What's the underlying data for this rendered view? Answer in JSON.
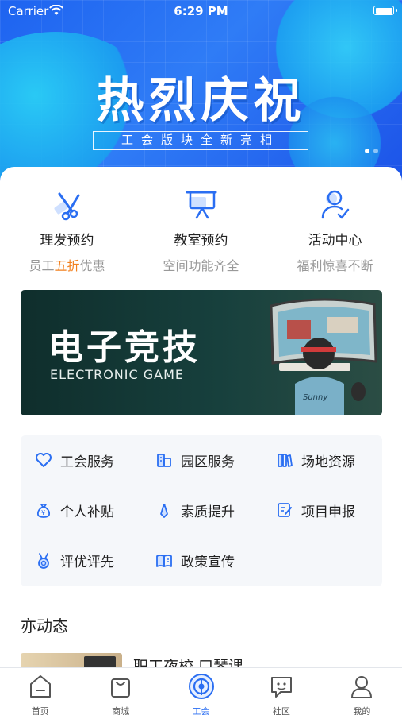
{
  "status_bar": {
    "carrier": "Carrier",
    "time": "6:29 PM"
  },
  "hero": {
    "title": "热烈庆祝",
    "subtitle": "工会版块全新亮相"
  },
  "quick_actions": [
    {
      "title": "理发预约",
      "sub_prefix": "员工",
      "sub_highlight": "五折",
      "sub_suffix": "优惠",
      "icon": "scissors-icon"
    },
    {
      "title": "教室预约",
      "sub_prefix": "空间功能齐全",
      "sub_highlight": "",
      "sub_suffix": "",
      "icon": "classroom-board-icon"
    },
    {
      "title": "活动中心",
      "sub_prefix": "福利惊喜不断",
      "sub_highlight": "",
      "sub_suffix": "",
      "icon": "user-activity-icon"
    }
  ],
  "game_banner": {
    "title": "电子竞技",
    "subtitle": "ELECTRONIC GAME",
    "jersey_text": "Sunny"
  },
  "services": [
    {
      "label": "工会服务",
      "icon": "heart-icon"
    },
    {
      "label": "园区服务",
      "icon": "buildings-icon"
    },
    {
      "label": "场地资源",
      "icon": "books-icon"
    },
    {
      "label": "个人补贴",
      "icon": "money-bag-icon"
    },
    {
      "label": "素质提升",
      "icon": "tie-icon"
    },
    {
      "label": "项目申报",
      "icon": "edit-document-icon"
    },
    {
      "label": "评优评先",
      "icon": "medal-icon"
    },
    {
      "label": "政策宣传",
      "icon": "open-book-icon"
    }
  ],
  "news": {
    "section_title": "亦动态",
    "first_item_text": "职工夜校 口琴课"
  },
  "tabbar": [
    {
      "label": "首页",
      "icon": "home-icon",
      "active": false
    },
    {
      "label": "商城",
      "icon": "shopping-bag-icon",
      "active": false
    },
    {
      "label": "工会",
      "icon": "union-icon",
      "active": true
    },
    {
      "label": "社区",
      "icon": "chat-icon",
      "active": false
    },
    {
      "label": "我的",
      "icon": "profile-icon",
      "active": false
    }
  ],
  "colors": {
    "accent": "#2a6ef2",
    "highlight": "#f2801e",
    "banner_bg": "#17403d"
  }
}
